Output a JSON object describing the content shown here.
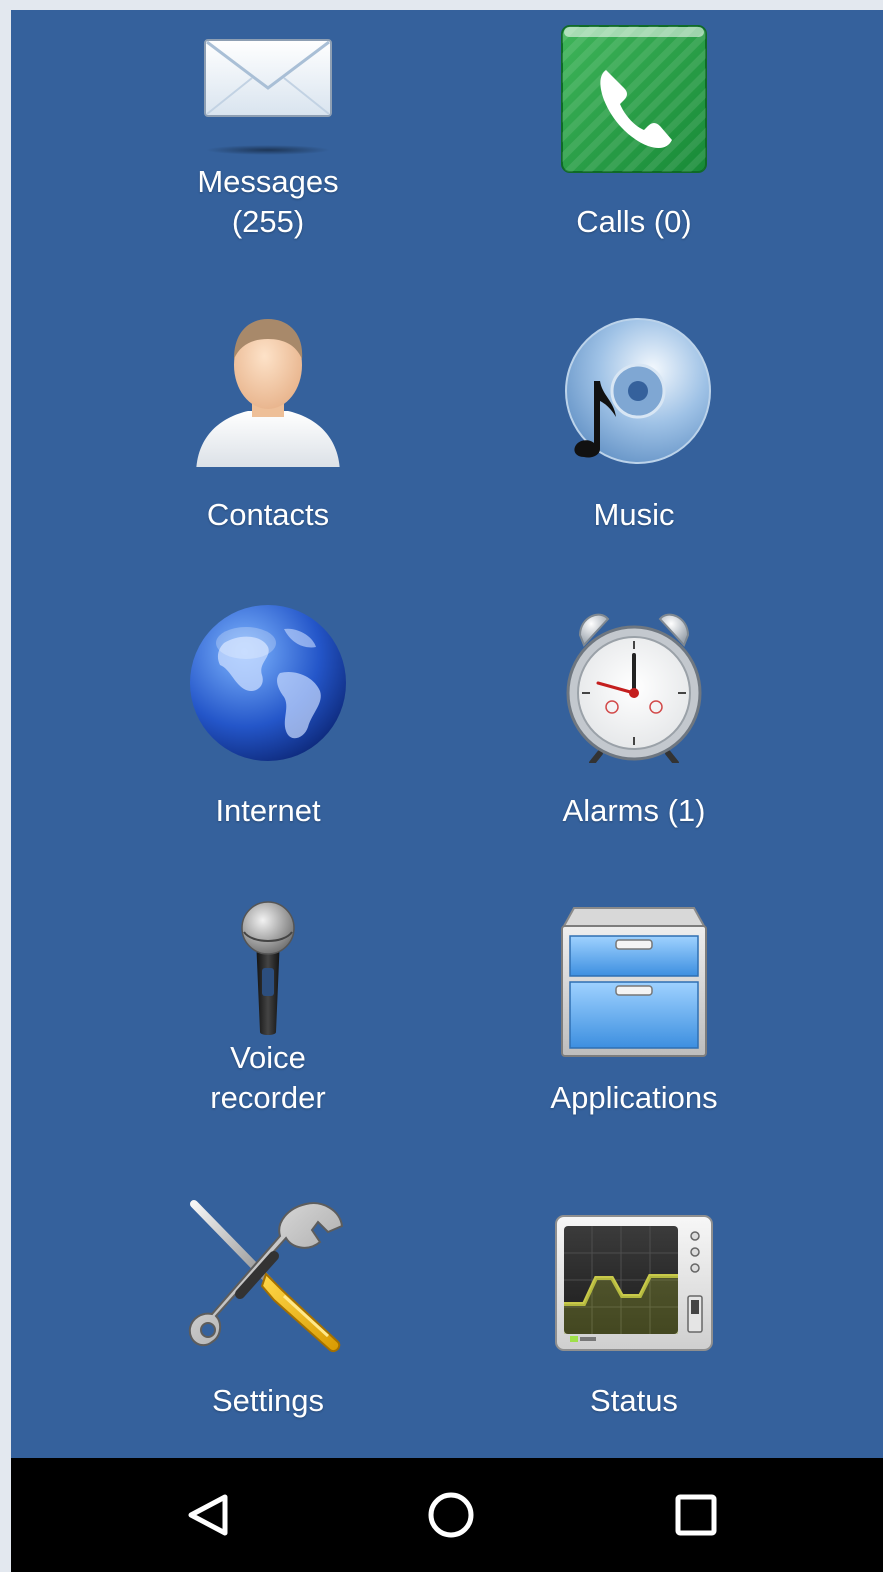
{
  "apps": [
    {
      "id": "messages",
      "label": "Messages\n(255)",
      "icon": "envelope-icon"
    },
    {
      "id": "calls",
      "label": "Calls (0)",
      "icon": "phone-icon"
    },
    {
      "id": "contacts",
      "label": "Contacts",
      "icon": "person-icon"
    },
    {
      "id": "music",
      "label": "Music",
      "icon": "music-disc-icon"
    },
    {
      "id": "internet",
      "label": "Internet",
      "icon": "globe-icon"
    },
    {
      "id": "alarms",
      "label": "Alarms (1)",
      "icon": "alarm-clock-icon"
    },
    {
      "id": "voice-recorder",
      "label": "Voice\nrecorder",
      "icon": "microphone-icon"
    },
    {
      "id": "applications",
      "label": "Applications",
      "icon": "cabinet-icon"
    },
    {
      "id": "settings",
      "label": "Settings",
      "icon": "tools-icon"
    },
    {
      "id": "status",
      "label": "Status",
      "icon": "monitor-icon"
    }
  ],
  "navbar": {
    "back_icon": "back-triangle-icon",
    "home_icon": "home-circle-icon",
    "recents_icon": "recents-square-icon"
  },
  "colors": {
    "background": "#35619c",
    "navbar": "#000000",
    "label": "#ffffff"
  }
}
